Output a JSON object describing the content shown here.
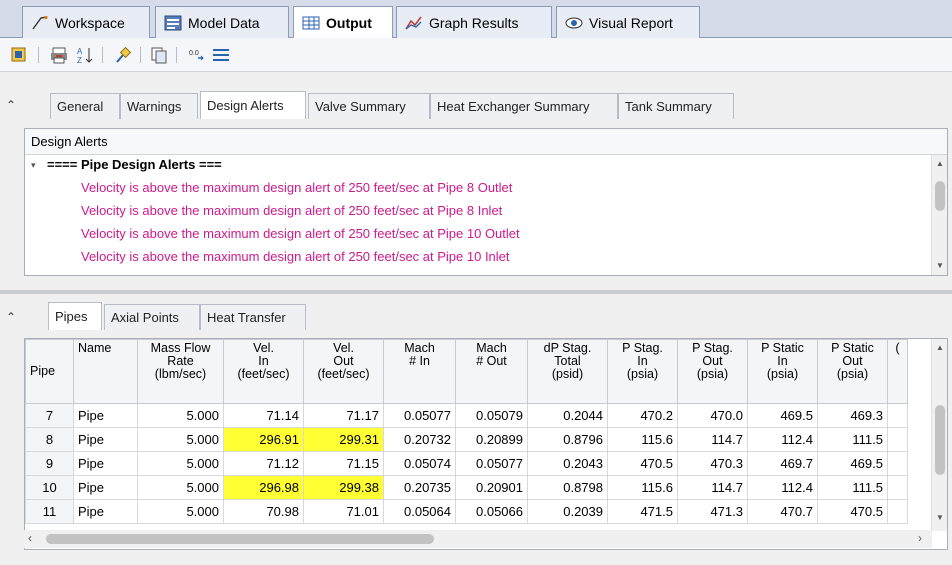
{
  "top_tabs": [
    {
      "label": "Workspace",
      "icon": "workspace-icon"
    },
    {
      "label": "Model Data",
      "icon": "model-data-icon"
    },
    {
      "label": "Output",
      "icon": "output-table-icon"
    },
    {
      "label": "Graph Results",
      "icon": "graph-icon"
    },
    {
      "label": "Visual Report",
      "icon": "eye-icon"
    }
  ],
  "section_tabs": [
    "General",
    "Warnings",
    "Design Alerts",
    "Valve Summary",
    "Heat Exchanger Summary",
    "Tank Summary"
  ],
  "alerts": {
    "header": "Design Alerts",
    "group_title": "==== Pipe Design Alerts ===",
    "lines": [
      "Velocity is above the maximum design alert of 250 feet/sec at Pipe 8 Outlet",
      "Velocity is above the maximum design alert of 250 feet/sec at Pipe 8 Inlet",
      "Velocity is above the maximum design alert of 250 feet/sec at Pipe 10 Outlet",
      "Velocity is above the maximum design alert of 250 feet/sec at Pipe 10 Inlet"
    ]
  },
  "lower_tabs": [
    "Pipes",
    "Axial Points",
    "Heat Transfer"
  ],
  "table": {
    "headers": [
      "Pipe",
      "Name",
      "Mass Flow\nRate\n(lbm/sec)",
      "Vel.\nIn\n(feet/sec)",
      "Vel.\nOut\n(feet/sec)",
      "Mach\n# In",
      "Mach\n# Out",
      "dP Stag.\nTotal\n(psid)",
      "P Stag.\nIn\n(psia)",
      "P Stag.\nOut\n(psia)",
      "P Static\nIn\n(psia)",
      "P Static\nOut\n(psia)",
      "("
    ],
    "rows": [
      [
        "7",
        "Pipe",
        "5.000",
        "71.14",
        "71.17",
        "0.05077",
        "0.05079",
        "0.2044",
        "470.2",
        "470.0",
        "469.5",
        "469.3"
      ],
      [
        "8",
        "Pipe",
        "5.000",
        "296.91",
        "299.31",
        "0.20732",
        "0.20899",
        "0.8796",
        "115.6",
        "114.7",
        "112.4",
        "111.5"
      ],
      [
        "9",
        "Pipe",
        "5.000",
        "71.12",
        "71.15",
        "0.05074",
        "0.05077",
        "0.2043",
        "470.5",
        "470.3",
        "469.7",
        "469.5"
      ],
      [
        "10",
        "Pipe",
        "5.000",
        "296.98",
        "299.38",
        "0.20735",
        "0.20901",
        "0.8798",
        "115.6",
        "114.7",
        "112.4",
        "111.5"
      ],
      [
        "11",
        "Pipe",
        "5.000",
        "70.98",
        "71.01",
        "0.05064",
        "0.05066",
        "0.2039",
        "471.5",
        "471.3",
        "470.7",
        "470.5"
      ]
    ]
  },
  "highlight_color": "#ffff33",
  "alert_color": "#cc1a8c"
}
